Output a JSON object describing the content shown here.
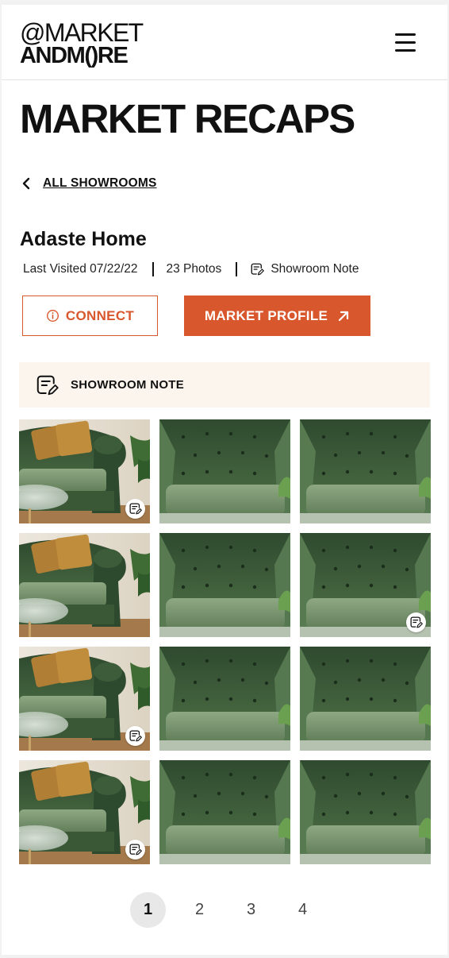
{
  "header": {
    "logo_top": "@MARKET",
    "logo_bottom": "ANDM()RE",
    "menu_icon": "hamburger-menu-icon"
  },
  "page_title": "MARKET RECAPS",
  "back_link": {
    "label": "ALL SHOWROOMS",
    "icon": "chevron-left-icon"
  },
  "showroom": {
    "name": "Adaste Home",
    "last_visited": "Last Visited 07/22/22",
    "photo_count": "23 Photos",
    "note_link": "Showroom Note",
    "note_icon": "note-edit-icon"
  },
  "buttons": {
    "connect": "CONNECT",
    "connect_icon": "info-icon",
    "profile": "MARKET PROFILE",
    "profile_icon": "arrow-up-right-icon"
  },
  "note_bar": {
    "label": "SHOWROOM NOTE",
    "icon": "note-edit-icon"
  },
  "photos": [
    {
      "kind": "chair",
      "has_note": true
    },
    {
      "kind": "sofa",
      "has_note": false
    },
    {
      "kind": "sofa",
      "has_note": false
    },
    {
      "kind": "chair",
      "has_note": false
    },
    {
      "kind": "sofa",
      "has_note": false
    },
    {
      "kind": "sofa",
      "has_note": true
    },
    {
      "kind": "chair",
      "has_note": true
    },
    {
      "kind": "sofa",
      "has_note": false
    },
    {
      "kind": "sofa",
      "has_note": false
    },
    {
      "kind": "chair",
      "has_note": true
    },
    {
      "kind": "sofa",
      "has_note": false
    },
    {
      "kind": "sofa",
      "has_note": false
    }
  ],
  "pagination": {
    "pages": [
      "1",
      "2",
      "3",
      "4"
    ],
    "current": "1"
  },
  "colors": {
    "accent": "#d9572c",
    "note_bg": "#fcf5ee",
    "sofa_green": "#3e5a3c"
  }
}
